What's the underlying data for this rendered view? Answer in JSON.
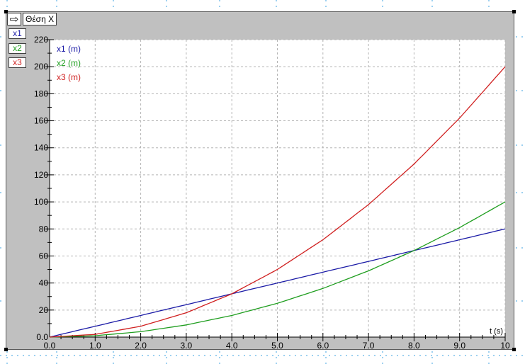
{
  "window": {
    "title": "Θέση X"
  },
  "series_buttons": [
    {
      "label": "x1",
      "color": "#1a1aa6",
      "bg": "#ffffff"
    },
    {
      "label": "x2",
      "color": "#1f9e1f",
      "bg": "#ffffff"
    },
    {
      "label": "x3",
      "color": "#d02020",
      "bg": "#ffffff"
    }
  ],
  "chart_data": {
    "type": "line",
    "xlabel": "t (s)",
    "xlim": [
      0,
      10
    ],
    "ylim": [
      0,
      220
    ],
    "grid": true,
    "legend_position": "top-left",
    "x_ticks": [
      "0.0",
      "1.0",
      "2.0",
      "3.0",
      "4.0",
      "5.0",
      "6.0",
      "7.0",
      "8.0",
      "9.0",
      "10"
    ],
    "y_ticks": [
      "0.0",
      "20",
      "40",
      "60",
      "80",
      "100",
      "120",
      "140",
      "160",
      "180",
      "200",
      "220"
    ],
    "x": [
      0,
      1,
      2,
      3,
      4,
      5,
      6,
      7,
      8,
      9,
      10
    ],
    "series": [
      {
        "name": "x1 (m)",
        "color": "#1a1aa6",
        "values": [
          0,
          8,
          16,
          24,
          32,
          40,
          48,
          56,
          64,
          72,
          80
        ]
      },
      {
        "name": "x2 (m)",
        "color": "#1f9e1f",
        "values": [
          0,
          1,
          4,
          9,
          16,
          25,
          36,
          49,
          64,
          81,
          100
        ]
      },
      {
        "name": "x3 (m)",
        "color": "#d02020",
        "values": [
          0,
          2,
          8,
          18,
          32,
          50,
          72,
          98,
          128,
          162,
          200
        ]
      }
    ]
  }
}
